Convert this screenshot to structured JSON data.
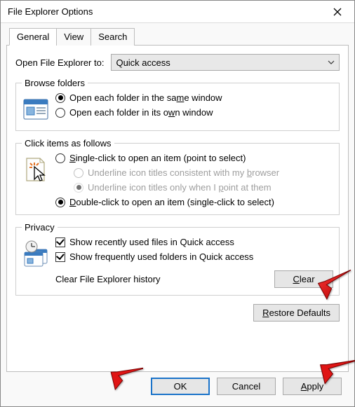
{
  "titlebar": {
    "title": "File Explorer Options"
  },
  "tabs": {
    "active": "General",
    "t1": "General",
    "t2": "View",
    "t3": "Search"
  },
  "open_to": {
    "label": "Open File Explorer to:",
    "value": "Quick access"
  },
  "browse": {
    "legend": "Browse folders",
    "same_pre": "Open each folder in the sa",
    "same_u": "m",
    "same_post": "e window",
    "own_pre": "Open each folder in its o",
    "own_u": "w",
    "own_post": "n window"
  },
  "click": {
    "legend": "Click items as follows",
    "single_u": "S",
    "single_post": "ingle-click to open an item (point to select)",
    "ul_b_pre": "Underline icon titles consistent with my ",
    "ul_b_u": "b",
    "ul_b_post": "rowser",
    "ul_p_pre": "Underline icon titles only when I ",
    "ul_p_u": "p",
    "ul_p_post": "oint at them",
    "double_u": "D",
    "double_post": "ouble-click to open an item (single-click to select)"
  },
  "privacy": {
    "legend": "Privacy",
    "recent": "Show recently used files in Quick access",
    "frequent": "Show frequently used folders in Quick access",
    "clear_label": "Clear File Explorer history",
    "clear_u": "C",
    "clear_post": "lear"
  },
  "restore": {
    "u": "R",
    "post": "estore Defaults"
  },
  "footer": {
    "ok": "OK",
    "cancel": "Cancel",
    "apply_u": "A",
    "apply_post": "pply"
  }
}
